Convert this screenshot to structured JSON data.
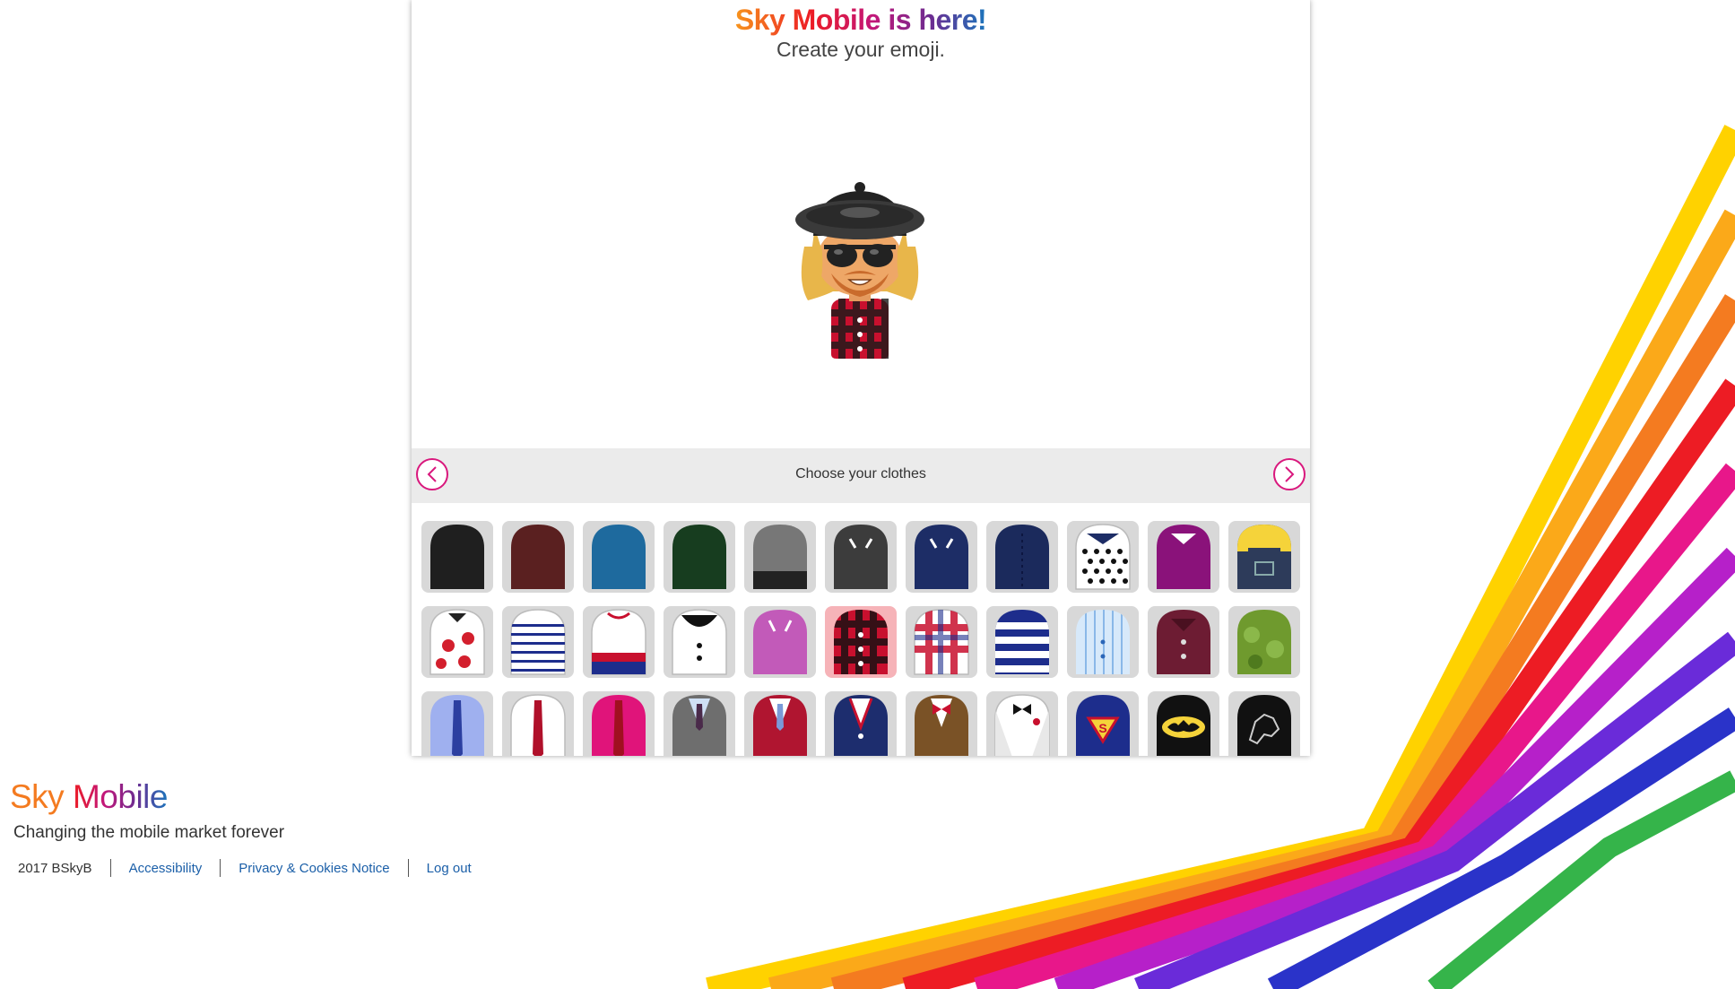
{
  "header": {
    "title": "Sky Mobile is here!",
    "subtitle": "Create your emoji."
  },
  "chooser": {
    "label": "Choose your clothes",
    "prev_icon": "chevron-left-icon",
    "next_icon": "chevron-right-icon",
    "selected_index": 16,
    "items": [
      {
        "name": "black-top"
      },
      {
        "name": "maroon-top"
      },
      {
        "name": "blue-top"
      },
      {
        "name": "dark-green-top"
      },
      {
        "name": "grey-black-top"
      },
      {
        "name": "dark-grey-collared-top"
      },
      {
        "name": "navy-collared-top"
      },
      {
        "name": "navy-buttoned-top"
      },
      {
        "name": "polka-dot-top"
      },
      {
        "name": "purple-collared-top"
      },
      {
        "name": "dungarees-top"
      },
      {
        "name": "floral-top"
      },
      {
        "name": "white-navy-stripe-top"
      },
      {
        "name": "sports-jumper-top"
      },
      {
        "name": "peter-pan-collar-top"
      },
      {
        "name": "pink-collared-top"
      },
      {
        "name": "red-check-shirt"
      },
      {
        "name": "red-blue-check-shirt"
      },
      {
        "name": "navy-white-stripe-top"
      },
      {
        "name": "light-blue-stripe-shirt"
      },
      {
        "name": "burgundy-shirt"
      },
      {
        "name": "green-camo-top"
      },
      {
        "name": "blue-tie-shirt"
      },
      {
        "name": "red-tie-shirt"
      },
      {
        "name": "pink-tie-shirt"
      },
      {
        "name": "grey-suit"
      },
      {
        "name": "red-suit"
      },
      {
        "name": "navy-suit"
      },
      {
        "name": "tweed-bowtie-suit"
      },
      {
        "name": "tuxedo"
      },
      {
        "name": "superman-top"
      },
      {
        "name": "batman-top"
      },
      {
        "name": "direwolf-top"
      }
    ]
  },
  "footer": {
    "brand_word1": "Sky",
    "brand_word2": "Mobile",
    "tagline": "Changing the mobile market forever",
    "copyright": "2017 BSkyB",
    "links": [
      "Accessibility",
      "Privacy & Cookies Notice",
      "Log out"
    ]
  },
  "colors": {
    "accent": "#d9187d",
    "link": "#1b5fa8",
    "headline_gradient": [
      "#f7941d",
      "#ed1c24",
      "#c2177a",
      "#6c2c91",
      "#1b75bc"
    ]
  }
}
